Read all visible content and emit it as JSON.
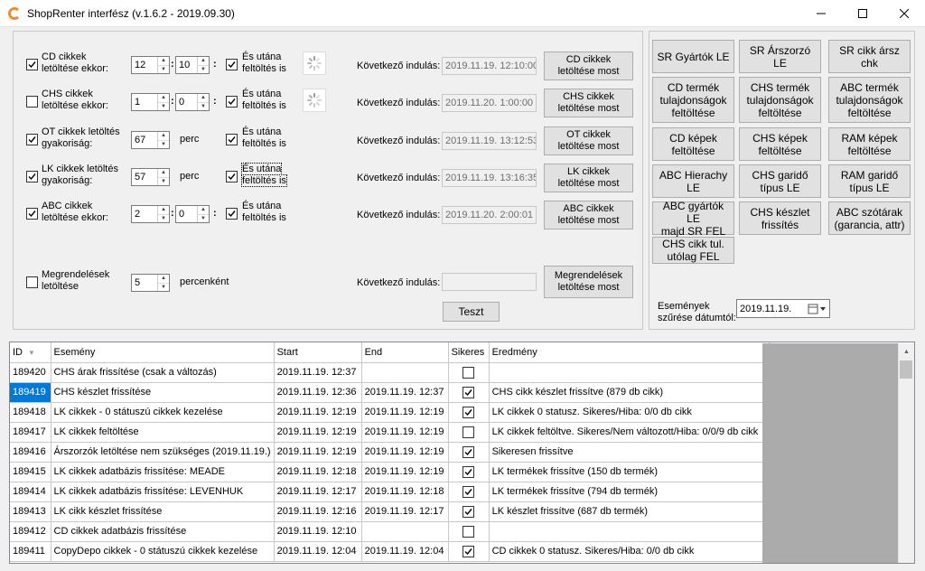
{
  "window": {
    "title": "ShopRenter interfész (v.1.6.2 - 2019.09.30)",
    "minimize": "–",
    "maximize": "☐",
    "close": "✕"
  },
  "schedules": [
    {
      "label_line1": "CD cikkek",
      "label_line2": "letöltése ekkor:",
      "checked": true,
      "type": "time",
      "hour": "12",
      "minute": "10",
      "after_line1": "És utána",
      "after_line2": "feltöltés is",
      "next_label": "Következő indulás:",
      "next_value": "2019.11.19. 12:10:00",
      "btn_line1": "CD cikkek",
      "btn_line2": "letöltése most"
    },
    {
      "label_line1": "CHS cikkek",
      "label_line2": "letöltése ekkor:",
      "checked": false,
      "type": "time",
      "hour": "1",
      "minute": "0",
      "after_line1": "És utána",
      "after_line2": "feltöltés is",
      "next_label": "Következő indulás:",
      "next_value": "2019.11.20. 1:00:00",
      "btn_line1": "CHS cikkek",
      "btn_line2": "letöltése most"
    },
    {
      "label_line1": "OT cikkek letöltés",
      "label_line2": "gyakoriság:",
      "checked": true,
      "type": "freq",
      "value": "67",
      "unit": "perc",
      "after_line1": "És utána",
      "after_line2": "feltöltés is",
      "next_label": "Következő indulás:",
      "next_value": "2019.11.19. 13:12:53",
      "btn_line1": "OT cikkek",
      "btn_line2": "letöltése most"
    },
    {
      "label_line1": "LK cikkek letöltés",
      "label_line2": "gyakoriság:",
      "checked": true,
      "type": "freq",
      "value": "57",
      "unit": "perc",
      "after_line1": "És utána",
      "after_line2": "feltöltés is",
      "next_label": "Következő indulás:",
      "next_value": "2019.11.19. 13:16:35",
      "btn_line1": "LK cikkek",
      "btn_line2": "letöltése most"
    },
    {
      "label_line1": "ABC cikkek",
      "label_line2": "letöltése ekkor:",
      "checked": true,
      "type": "time",
      "hour": "2",
      "minute": "0",
      "after_line1": "És utána",
      "after_line2": "feltöltés is",
      "next_label": "Következő indulás:",
      "next_value": "2019.11.20. 2:00:01",
      "btn_line1": "ABC cikkek",
      "btn_line2": "letöltése most"
    }
  ],
  "time_separator": ":",
  "orders": {
    "label_line1": "Megrendelések",
    "label_line2": "letöltése",
    "checked": false,
    "value": "5",
    "unit": "percenként",
    "next_label": "Következő indulás:",
    "next_value": "",
    "btn_line1": "Megrendelések",
    "btn_line2": "letöltése most"
  },
  "test_button": "Teszt",
  "action_buttons": [
    {
      "line1": "SR Gyártók LE",
      "line2": ""
    },
    {
      "line1": "SR Árszorzó LE",
      "line2": ""
    },
    {
      "line1": "SR cikk ársz",
      "line2": "chk"
    },
    {
      "line1": "CD termék",
      "line2": "tulajdonságok",
      "line3": "feltöltése"
    },
    {
      "line1": "CHS termék",
      "line2": "tulajdonságok",
      "line3": "feltöltése"
    },
    {
      "line1": "ABC termék",
      "line2": "tulajdonságok",
      "line3": "feltöltése"
    },
    {
      "line1": "CD képek",
      "line2": "feltöltése"
    },
    {
      "line1": "CHS képek",
      "line2": "feltöltése"
    },
    {
      "line1": "RAM képek",
      "line2": "feltöltése"
    },
    {
      "line1": "ABC Hierachy",
      "line2": "LE"
    },
    {
      "line1": "CHS garidő",
      "line2": "típus LE"
    },
    {
      "line1": "RAM garidő",
      "line2": "típus LE"
    },
    {
      "line1": "ABC gyártók LE",
      "line2": "majd SR FEL"
    },
    {
      "line1": "CHS készlet",
      "line2": "frissítés"
    },
    {
      "line1": "ABC szótárak",
      "line2": "(garancia, attr)"
    },
    {
      "line1": "CHS cikk tul.",
      "line2": "utólag FEL"
    }
  ],
  "filter": {
    "label_line1": "Események",
    "label_line2": "szűrése dátumtól:",
    "date": "2019.11.19."
  },
  "grid": {
    "columns": [
      "ID",
      "Esemény",
      "Start",
      "End",
      "Sikeres",
      "Eredmény"
    ],
    "rows": [
      {
        "id": "189420",
        "event": "CHS árak frissítése (csak a változás)",
        "start": "2019.11.19. 12:37",
        "end": "",
        "success": false,
        "result": ""
      },
      {
        "id": "189419",
        "event": "CHS készlet frissítése",
        "start": "2019.11.19. 12:36",
        "end": "2019.11.19. 12:37",
        "success": true,
        "result": "CHS cikk készlet frissítve (879 db cikk)"
      },
      {
        "id": "189418",
        "event": "LK cikkek - 0 státuszú cikkek kezelése",
        "start": "2019.11.19. 12:19",
        "end": "2019.11.19. 12:19",
        "success": true,
        "result": "LK cikkek 0 statusz. Sikeres/Hiba: 0/0 db cikk"
      },
      {
        "id": "189417",
        "event": "LK cikkek feltöltése",
        "start": "2019.11.19. 12:19",
        "end": "2019.11.19. 12:19",
        "success": false,
        "result": "LK cikkek feltöltve. Sikeres/Nem változott/Hiba: 0/0/9 db cikk"
      },
      {
        "id": "189416",
        "event": "Árszorzók letöltése nem szükséges (2019.11.19.)",
        "start": "2019.11.19. 12:19",
        "end": "2019.11.19. 12:19",
        "success": true,
        "result": "Sikeresen frissítve"
      },
      {
        "id": "189415",
        "event": "LK cikkek adatbázis frissítése: MEADE",
        "start": "2019.11.19. 12:18",
        "end": "2019.11.19. 12:19",
        "success": true,
        "result": "LK termékek frissítve (150 db termék)"
      },
      {
        "id": "189414",
        "event": "LK cikkek adatbázis frissítése: LEVENHUK",
        "start": "2019.11.19. 12:17",
        "end": "2019.11.19. 12:18",
        "success": true,
        "result": "LK termékek frissítve (794 db termék)"
      },
      {
        "id": "189413",
        "event": "LK cikk készlet frissítése",
        "start": "2019.11.19. 12:16",
        "end": "2019.11.19. 12:17",
        "success": true,
        "result": "LK készlet frissítve (687 db termék)"
      },
      {
        "id": "189412",
        "event": "CD cikkek adatbázis frissítése",
        "start": "2019.11.19. 12:10",
        "end": "",
        "success": false,
        "result": ""
      },
      {
        "id": "189411",
        "event": "CopyDepo cikkek - 0 státuszú cikkek kezelése",
        "start": "2019.11.19. 12:04",
        "end": "2019.11.19. 12:04",
        "success": true,
        "result": "CD cikkek 0 statusz. Sikeres/Hiba: 0/0 db cikk"
      }
    ],
    "selected_id": "189419"
  }
}
